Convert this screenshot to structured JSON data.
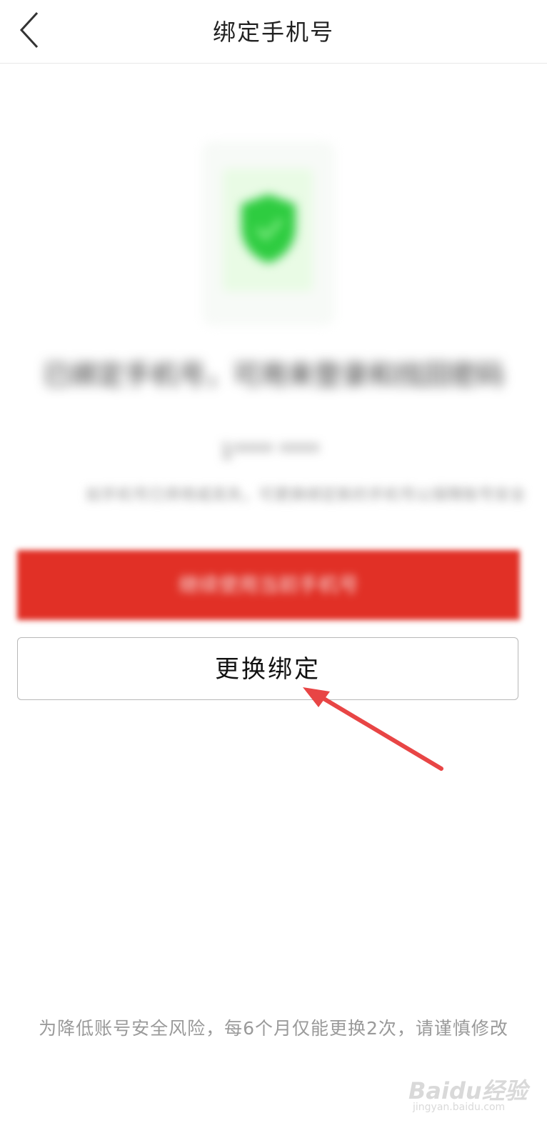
{
  "header": {
    "title": "绑定手机号",
    "back_icon": "chevron-left-icon"
  },
  "status": {
    "shield_icon": "shield-check-icon",
    "shield_color": "#2ecc40",
    "message_blurred": "已绑定手机号，可用来登录和找回密码",
    "phone_blurred": "1**** ****",
    "description_blurred": "如手机号已停用或丢失，可更换绑定新的手机号以保障账号安全"
  },
  "actions": {
    "primary_blurred_label": "继续使用当前手机号",
    "primary_color": "#e13026",
    "change_binding_label": "更换绑定"
  },
  "footer": {
    "note": "为降低账号安全风险，每6个月仅能更换2次，请谨慎修改"
  },
  "watermark": {
    "text": "Baidu经验",
    "subtext": "jingyan.baidu.com"
  },
  "annotation": {
    "arrow_color": "#e84545"
  }
}
